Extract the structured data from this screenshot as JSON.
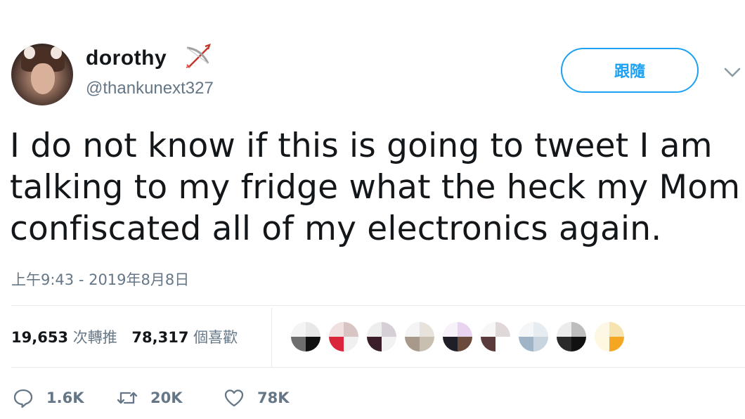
{
  "user": {
    "display_name": "dorothy",
    "handle": "@thankunext327",
    "name_emoji": "bow-and-arrow-icon"
  },
  "follow": {
    "label": "跟隨"
  },
  "tweet": {
    "text": "I do not know if this is going to tweet I am talking to my fridge what the heck my Mom confiscated all of my electronics again.",
    "timestamp": "上午9:43 - 2019年8月8日"
  },
  "stats": {
    "retweets_count": "19,653",
    "retweets_label": "次轉推",
    "likes_count": "78,317",
    "likes_label": "個喜歡"
  },
  "likers": [
    {
      "c": [
        "#f4f4f4",
        "#e8e8e8",
        "#6e6e6e",
        "#111111"
      ]
    },
    {
      "c": [
        "#f0e0e0",
        "#d9c4c4",
        "#d9263a",
        "#f0f0f0"
      ]
    },
    {
      "c": [
        "#eeeeee",
        "#d6cfd6",
        "#3a1f2a",
        "#f2f2f2"
      ]
    },
    {
      "c": [
        "#f4f4f4",
        "#e8e2dc",
        "#a89a8a",
        "#c9bfb0"
      ]
    },
    {
      "c": [
        "#f7f2fa",
        "#e8d4f0",
        "#1f1f2a",
        "#6a4a3a"
      ]
    },
    {
      "c": [
        "#f7f7f7",
        "#e0d8d8",
        "#5a3a3a",
        "#ffffff"
      ]
    },
    {
      "c": [
        "#f4f6f8",
        "#e6ecf0",
        "#a0b4c8",
        "#c8d4de"
      ]
    },
    {
      "c": [
        "#ececec",
        "#bdbdbd",
        "#2a2a2a",
        "#111111"
      ]
    },
    {
      "c": [
        "#fdf7e6",
        "#f5e3b0",
        "#fff8e0",
        "#f5a623"
      ]
    }
  ],
  "actions": {
    "reply_count": "1.6K",
    "retweet_count": "20K",
    "like_count": "78K"
  },
  "colors": {
    "accent": "#1da1f2",
    "muted": "#657786",
    "text": "#14171a"
  }
}
